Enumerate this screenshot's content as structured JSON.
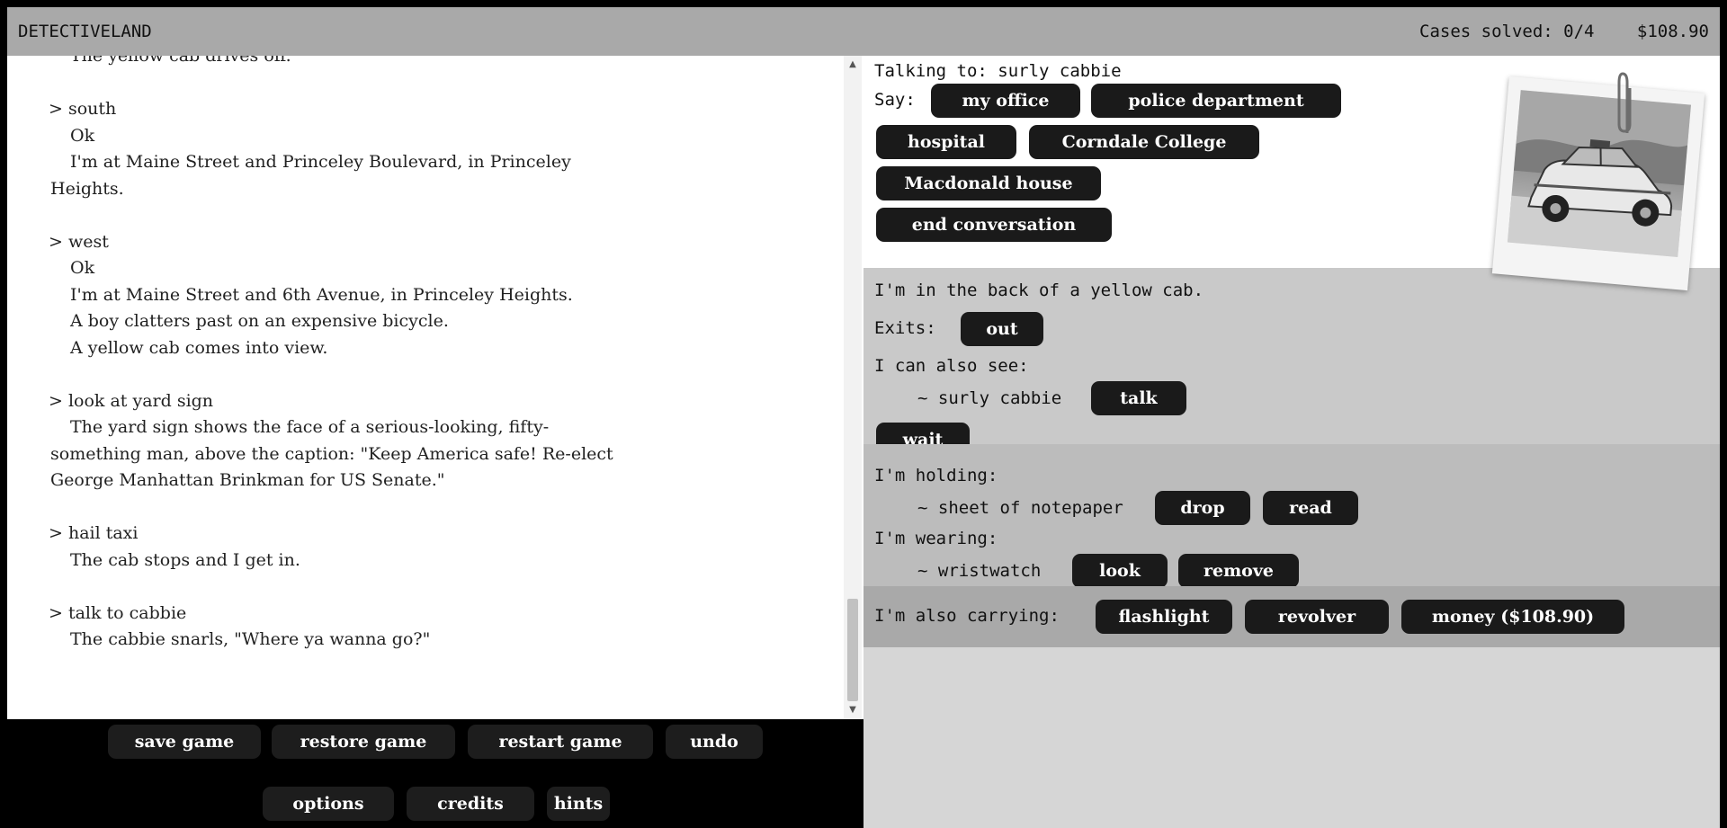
{
  "header": {
    "title": "DETECTIVELAND",
    "cases_solved": "Cases solved: 0/4",
    "money": "$108.90"
  },
  "transcript": {
    "entries": [
      {
        "lines": [
          "The yellow cab drives off."
        ]
      },
      {
        "cmd": "> south",
        "lines": [
          "Ok",
          "I'm at Maine Street and Princeley Boulevard, in Princeley",
          "Heights."
        ]
      },
      {
        "cmd": "> west",
        "lines": [
          "Ok",
          "I'm at Maine Street and 6th Avenue, in Princeley Heights.",
          "A boy clatters past on an expensive bicycle.",
          "A yellow cab comes into view."
        ]
      },
      {
        "cmd": "> look at yard sign",
        "lines": [
          "The yard sign shows the face of a serious-looking, fifty-",
          "something man, above the caption: \"Keep America safe! Re-elect",
          "George Manhattan Brinkman for US Senate.\""
        ]
      },
      {
        "cmd": "> hail taxi",
        "lines": [
          "The cab stops and I get in."
        ]
      },
      {
        "cmd": "> talk to cabbie",
        "lines": [
          "The cabbie snarls, \"Where ya wanna go?\""
        ]
      }
    ]
  },
  "system_buttons": {
    "save": "save game",
    "restore": "restore game",
    "restart": "restart game",
    "undo": "undo",
    "options": "options",
    "credits": "credits",
    "hints": "hints"
  },
  "conversation": {
    "talking_to": "Talking to: surly cabbie",
    "say_label": "Say:",
    "options": [
      "my office",
      "police department",
      "hospital",
      "Corndale College",
      "Macdonald house",
      "end conversation"
    ]
  },
  "room": {
    "description": "I'm in the back of a yellow cab.",
    "exits_label": "Exits:",
    "exits": [
      "out"
    ],
    "see_label": "I can also see:",
    "npc": "~ surly cabbie",
    "npc_action": "talk",
    "wait": "wait"
  },
  "inventory": {
    "holding_label": "I'm holding:",
    "held_item": "~ sheet of notepaper",
    "held_actions": [
      "drop",
      "read"
    ],
    "wearing_label": "I'm wearing:",
    "worn_item": "~ wristwatch",
    "worn_actions": [
      "look",
      "remove"
    ],
    "carrying_label": "I'm also carrying:",
    "carried": [
      "flashlight",
      "revolver",
      "money ($108.90)"
    ]
  },
  "icons": {
    "photo": "taxi-photo-icon",
    "clip": "paperclip-icon"
  }
}
